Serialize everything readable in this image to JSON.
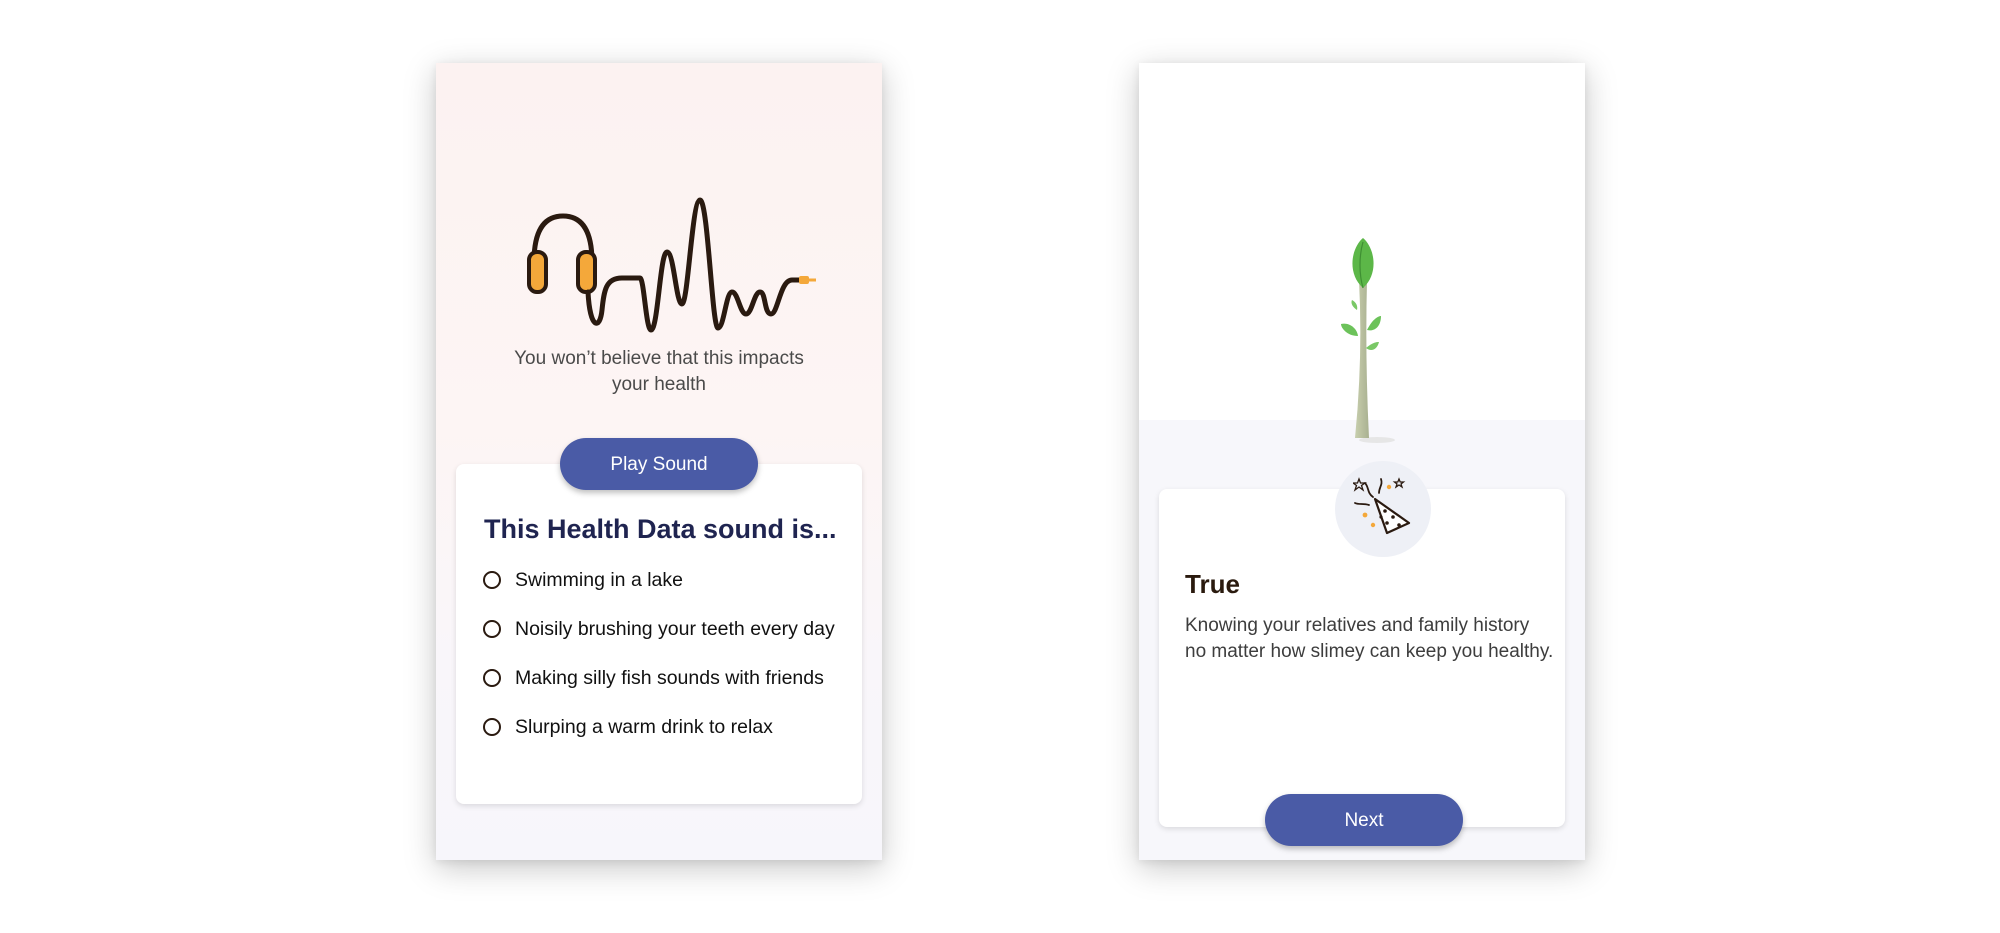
{
  "quiz_screen": {
    "subtitle": "You won’t believe that this impacts your health",
    "play_button": "Play Sound",
    "question": "This Health Data sound is...",
    "options": [
      "Swimming in a lake",
      "Noisily brushing your teeth every day",
      "Making silly fish sounds with friends",
      "Slurping a warm drink to relax"
    ]
  },
  "result_screen": {
    "result_title": "True",
    "result_text": "Knowing your relatives and family history no matter how slimey can keep you healthy.",
    "next_button": "Next"
  },
  "icons": {
    "hero_left": "headphones-soundwave-icon",
    "hero_right": "sprout-tree-icon",
    "badge": "party-popper-icon"
  },
  "colors": {
    "primary_button": "#4a5ba6",
    "headline": "#1f2450",
    "accent_orange": "#f4a83a",
    "leaf_green": "#5cb748"
  }
}
